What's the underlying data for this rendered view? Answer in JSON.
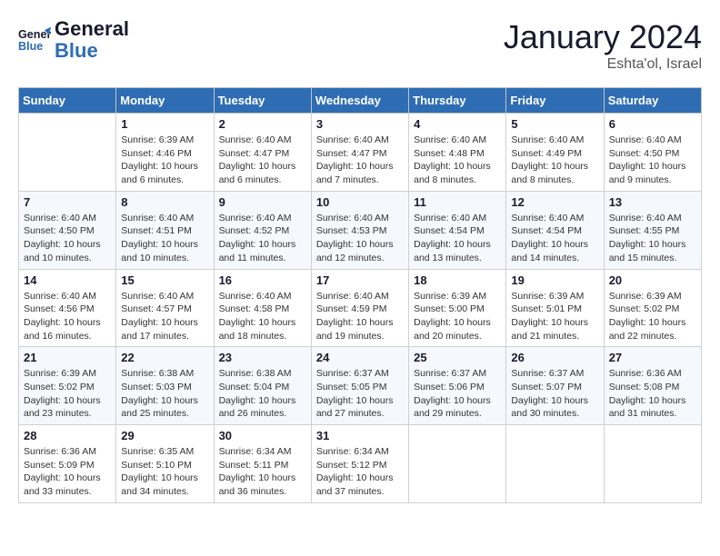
{
  "header": {
    "logo_line1": "General",
    "logo_line2": "Blue",
    "month": "January 2024",
    "location": "Eshta'ol, Israel"
  },
  "weekdays": [
    "Sunday",
    "Monday",
    "Tuesday",
    "Wednesday",
    "Thursday",
    "Friday",
    "Saturday"
  ],
  "weeks": [
    [
      {
        "day": "",
        "info": ""
      },
      {
        "day": "1",
        "info": "Sunrise: 6:39 AM\nSunset: 4:46 PM\nDaylight: 10 hours\nand 6 minutes."
      },
      {
        "day": "2",
        "info": "Sunrise: 6:40 AM\nSunset: 4:47 PM\nDaylight: 10 hours\nand 6 minutes."
      },
      {
        "day": "3",
        "info": "Sunrise: 6:40 AM\nSunset: 4:47 PM\nDaylight: 10 hours\nand 7 minutes."
      },
      {
        "day": "4",
        "info": "Sunrise: 6:40 AM\nSunset: 4:48 PM\nDaylight: 10 hours\nand 8 minutes."
      },
      {
        "day": "5",
        "info": "Sunrise: 6:40 AM\nSunset: 4:49 PM\nDaylight: 10 hours\nand 8 minutes."
      },
      {
        "day": "6",
        "info": "Sunrise: 6:40 AM\nSunset: 4:50 PM\nDaylight: 10 hours\nand 9 minutes."
      }
    ],
    [
      {
        "day": "7",
        "info": "Sunrise: 6:40 AM\nSunset: 4:50 PM\nDaylight: 10 hours\nand 10 minutes."
      },
      {
        "day": "8",
        "info": "Sunrise: 6:40 AM\nSunset: 4:51 PM\nDaylight: 10 hours\nand 10 minutes."
      },
      {
        "day": "9",
        "info": "Sunrise: 6:40 AM\nSunset: 4:52 PM\nDaylight: 10 hours\nand 11 minutes."
      },
      {
        "day": "10",
        "info": "Sunrise: 6:40 AM\nSunset: 4:53 PM\nDaylight: 10 hours\nand 12 minutes."
      },
      {
        "day": "11",
        "info": "Sunrise: 6:40 AM\nSunset: 4:54 PM\nDaylight: 10 hours\nand 13 minutes."
      },
      {
        "day": "12",
        "info": "Sunrise: 6:40 AM\nSunset: 4:54 PM\nDaylight: 10 hours\nand 14 minutes."
      },
      {
        "day": "13",
        "info": "Sunrise: 6:40 AM\nSunset: 4:55 PM\nDaylight: 10 hours\nand 15 minutes."
      }
    ],
    [
      {
        "day": "14",
        "info": "Sunrise: 6:40 AM\nSunset: 4:56 PM\nDaylight: 10 hours\nand 16 minutes."
      },
      {
        "day": "15",
        "info": "Sunrise: 6:40 AM\nSunset: 4:57 PM\nDaylight: 10 hours\nand 17 minutes."
      },
      {
        "day": "16",
        "info": "Sunrise: 6:40 AM\nSunset: 4:58 PM\nDaylight: 10 hours\nand 18 minutes."
      },
      {
        "day": "17",
        "info": "Sunrise: 6:40 AM\nSunset: 4:59 PM\nDaylight: 10 hours\nand 19 minutes."
      },
      {
        "day": "18",
        "info": "Sunrise: 6:39 AM\nSunset: 5:00 PM\nDaylight: 10 hours\nand 20 minutes."
      },
      {
        "day": "19",
        "info": "Sunrise: 6:39 AM\nSunset: 5:01 PM\nDaylight: 10 hours\nand 21 minutes."
      },
      {
        "day": "20",
        "info": "Sunrise: 6:39 AM\nSunset: 5:02 PM\nDaylight: 10 hours\nand 22 minutes."
      }
    ],
    [
      {
        "day": "21",
        "info": "Sunrise: 6:39 AM\nSunset: 5:02 PM\nDaylight: 10 hours\nand 23 minutes."
      },
      {
        "day": "22",
        "info": "Sunrise: 6:38 AM\nSunset: 5:03 PM\nDaylight: 10 hours\nand 25 minutes."
      },
      {
        "day": "23",
        "info": "Sunrise: 6:38 AM\nSunset: 5:04 PM\nDaylight: 10 hours\nand 26 minutes."
      },
      {
        "day": "24",
        "info": "Sunrise: 6:37 AM\nSunset: 5:05 PM\nDaylight: 10 hours\nand 27 minutes."
      },
      {
        "day": "25",
        "info": "Sunrise: 6:37 AM\nSunset: 5:06 PM\nDaylight: 10 hours\nand 29 minutes."
      },
      {
        "day": "26",
        "info": "Sunrise: 6:37 AM\nSunset: 5:07 PM\nDaylight: 10 hours\nand 30 minutes."
      },
      {
        "day": "27",
        "info": "Sunrise: 6:36 AM\nSunset: 5:08 PM\nDaylight: 10 hours\nand 31 minutes."
      }
    ],
    [
      {
        "day": "28",
        "info": "Sunrise: 6:36 AM\nSunset: 5:09 PM\nDaylight: 10 hours\nand 33 minutes."
      },
      {
        "day": "29",
        "info": "Sunrise: 6:35 AM\nSunset: 5:10 PM\nDaylight: 10 hours\nand 34 minutes."
      },
      {
        "day": "30",
        "info": "Sunrise: 6:34 AM\nSunset: 5:11 PM\nDaylight: 10 hours\nand 36 minutes."
      },
      {
        "day": "31",
        "info": "Sunrise: 6:34 AM\nSunset: 5:12 PM\nDaylight: 10 hours\nand 37 minutes."
      },
      {
        "day": "",
        "info": ""
      },
      {
        "day": "",
        "info": ""
      },
      {
        "day": "",
        "info": ""
      }
    ]
  ]
}
